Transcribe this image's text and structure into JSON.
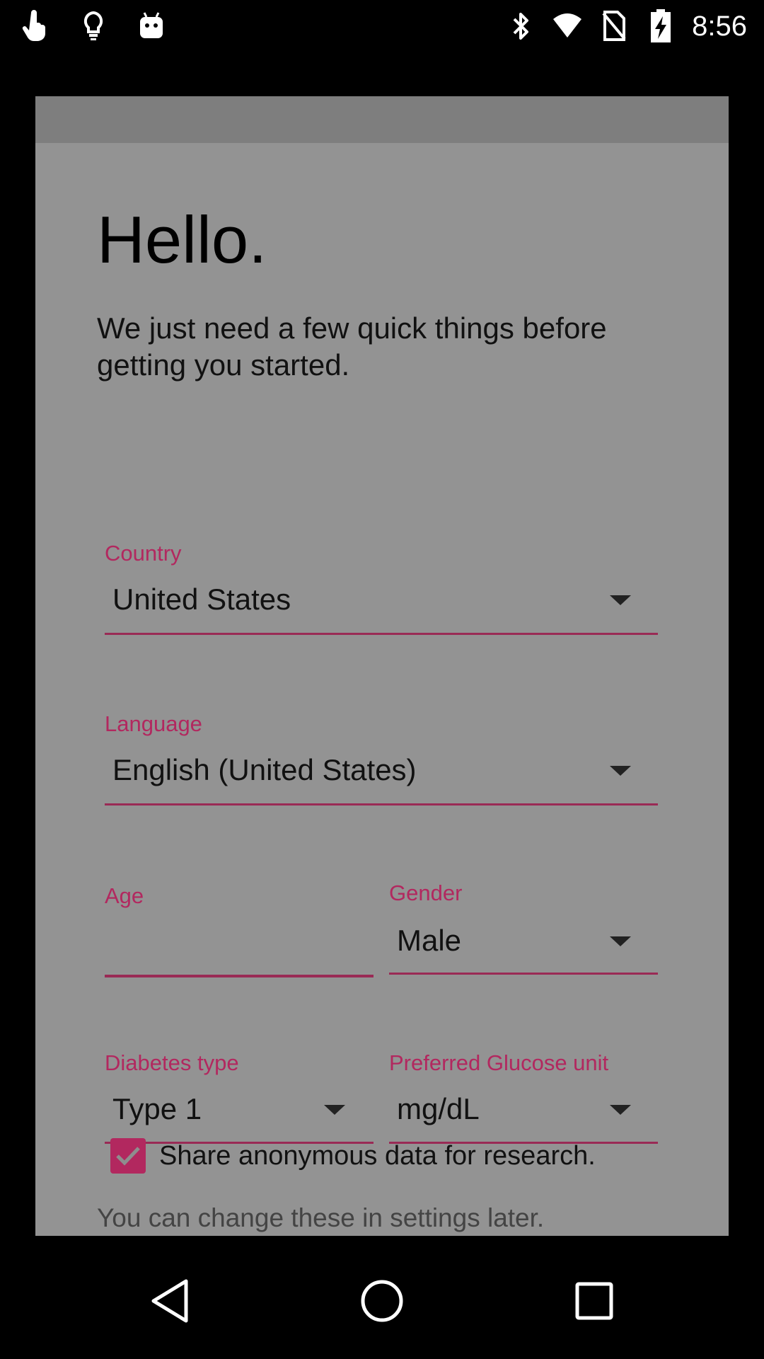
{
  "status_bar": {
    "time": "8:56",
    "left_icons": [
      "hand-pointer-icon",
      "lightbulb-icon",
      "android-icon"
    ],
    "right_icons": [
      "bluetooth-icon",
      "wifi-icon",
      "no-sim-icon",
      "battery-charging-icon"
    ]
  },
  "dialog": {
    "title": "Hello.",
    "intro": "We just need a few quick things before getting you started.",
    "country": {
      "label": "Country",
      "value": "United States"
    },
    "language": {
      "label": "Language",
      "value": "English (United States)"
    },
    "age": {
      "label": "Age",
      "value": ""
    },
    "gender": {
      "label": "Gender",
      "value": "Male"
    },
    "diabetes_type": {
      "label": "Diabetes type",
      "value": "Type 1"
    },
    "glucose_unit": {
      "label": "Preferred Glucose unit",
      "value": "mg/dL"
    },
    "share": {
      "label": "Share anonymous data for research.",
      "checked": true
    },
    "footer_note": "You can change these in settings later."
  },
  "colors": {
    "accent": "#b2285f",
    "scrim": "#939393",
    "header": "#7e7e7e"
  },
  "nav_bar": {
    "buttons": [
      "back-icon",
      "home-icon",
      "recents-icon"
    ]
  }
}
